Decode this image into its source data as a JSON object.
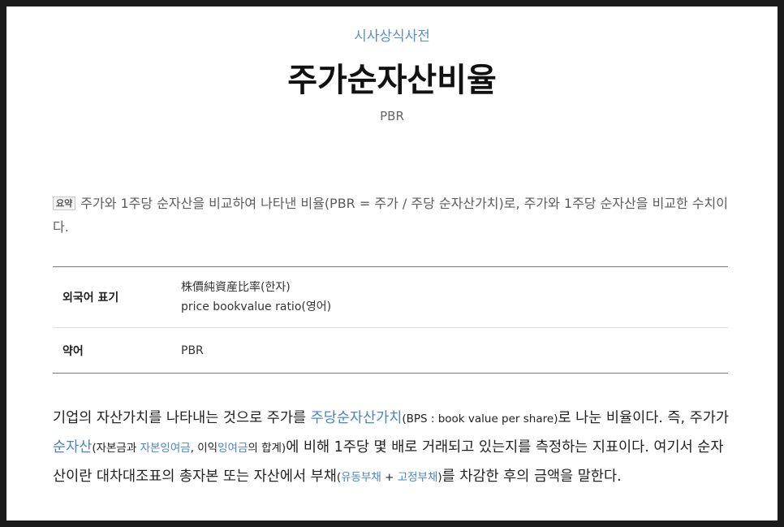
{
  "header": {
    "category": "시사상식사전",
    "title": "주가순자산비율",
    "subtitle": "PBR"
  },
  "summary": {
    "badge": "요약",
    "text": "주가와 1주당 순자산을 비교하여 나타낸 비율(PBR = 주가 / 주당 순자산가치)로, 주가와 1주당 순자산을 비교한 수치이다."
  },
  "info_table": {
    "rows": [
      {
        "label": "외국어 표기",
        "values": [
          "株價純資産比率(한자)",
          "price bookvalue ratio(영어)"
        ]
      },
      {
        "label": "약어",
        "values": [
          "PBR"
        ]
      }
    ]
  },
  "body": {
    "t1": "기업의 자산가치를 나타내는 것으로 주가를 ",
    "link_bps": "주당순자산가치",
    "t2_small": "(BPS : book value per share)",
    "t3": "로 나눈 비율이다. 즉, 주가가 ",
    "link_net_assets": "순자산",
    "t4_small": "(자본금과 ",
    "link_capital_surplus": "자본잉여금",
    "t5_small": ", 이익",
    "link_retained_earnings": "잉여금",
    "t6_small": "의 합계)",
    "t7": "에 비해 1주당 몇 배로 거래되고 있는지를 측정하는 지표이다. 여기서 순자산이란 대차대조표의 총자본 또는 자산에서 부채",
    "t8_small": "(",
    "link_current_liabilities": "유동부채",
    "t9_small": " + ",
    "link_fixed_liabilities": "고정부채",
    "t10_small": ")",
    "t11": "를 차감한 후의 금액을 말한다."
  },
  "colors": {
    "link": "#4a86c5",
    "category": "#5f8fc7",
    "frame": "#1b1b1b"
  }
}
